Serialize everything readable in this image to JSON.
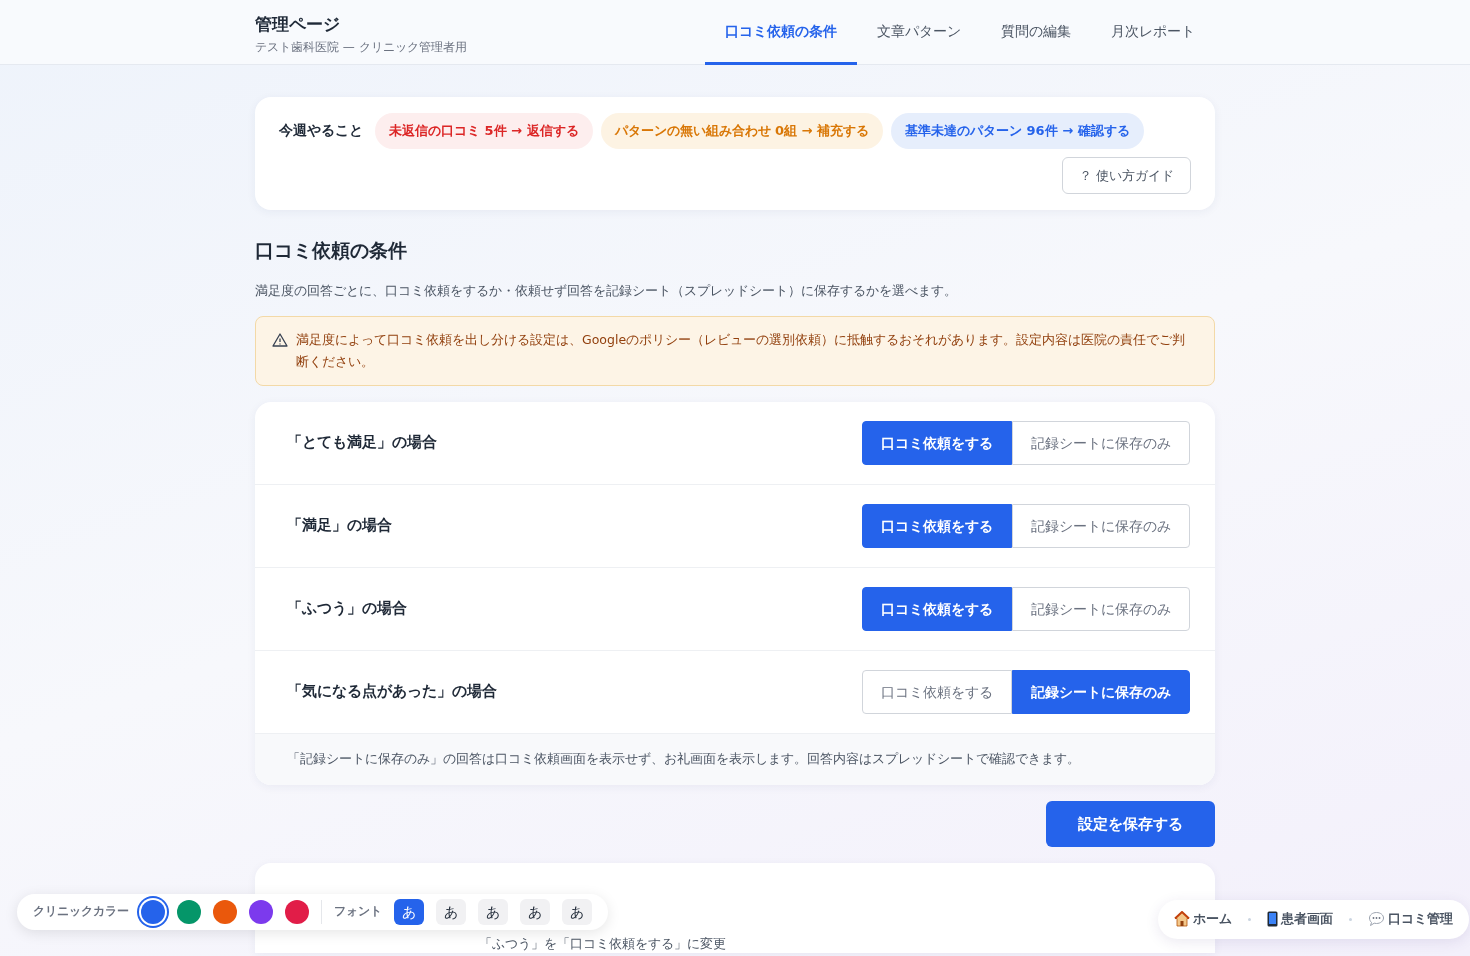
{
  "header": {
    "title": "管理ページ",
    "subtitle": "テスト歯科医院 — クリニック管理者用"
  },
  "tabs": [
    {
      "label": "口コミ依頼の条件",
      "selected": true
    },
    {
      "label": "文章パターン",
      "selected": false
    },
    {
      "label": "質問の編集",
      "selected": false
    },
    {
      "label": "月次レポート",
      "selected": false
    }
  ],
  "todo": {
    "label": "今週やること",
    "items": [
      {
        "text": "未返信の口コミ 5件 → 返信する",
        "kind": "danger"
      },
      {
        "text": "パターンの無い組み合わせ 0組 → 補充する",
        "kind": "warning"
      },
      {
        "text": "基準未達のパターン 96件 → 確認する",
        "kind": "info"
      }
    ],
    "guide_button": "？ 使い方ガイド"
  },
  "section": {
    "title": "口コミ依頼の条件",
    "description": "満足度の回答ごとに、口コミ依頼をするか・依頼せず回答を記録シート（スプレッドシート）に保存するかを選べます。",
    "warning": "満足度によって口コミ依頼を出し分ける設定は、Googleのポリシー（レビューの選別依頼）に抵触するおそれがあります。設定内容は医院の責任でご判断ください。"
  },
  "conditions": [
    {
      "label": "「とても満足」の場合",
      "options": [
        {
          "text": "口コミ依頼をする",
          "selected": true
        },
        {
          "text": "記録シートに保存のみ",
          "selected": false
        }
      ]
    },
    {
      "label": "「満足」の場合",
      "options": [
        {
          "text": "口コミ依頼をする",
          "selected": true
        },
        {
          "text": "記録シートに保存のみ",
          "selected": false
        }
      ]
    },
    {
      "label": "「ふつう」の場合",
      "options": [
        {
          "text": "口コミ依頼をする",
          "selected": true
        },
        {
          "text": "記録シートに保存のみ",
          "selected": false
        }
      ]
    },
    {
      "label": "「気になる点があった」の場合",
      "options": [
        {
          "text": "口コミ依頼をする",
          "selected": false
        },
        {
          "text": "記録シートに保存のみ",
          "selected": true
        }
      ]
    }
  ],
  "note": "「記録シートに保存のみ」の回答は口コミ依頼画面を表示せず、お礼画面を表示します。回答内容はスプレッドシートで確認できます。",
  "save_button": "設定を保存する",
  "history": {
    "rows": [
      {
        "column_3": "「ふつう」を「口コミ依頼をする」に変更"
      }
    ]
  },
  "color_bar": {
    "label": "クリニックカラー",
    "colors": [
      {
        "color": "#2563eb",
        "selected": true
      },
      {
        "color": "#059669",
        "selected": false
      },
      {
        "color": "#ea580c",
        "selected": false
      },
      {
        "color": "#7c3aed",
        "selected": false
      },
      {
        "color": "#e11d48",
        "selected": false
      }
    ],
    "font_label": "フォント",
    "fonts": [
      {
        "text": "あ",
        "selected": true
      },
      {
        "text": "あ",
        "selected": false
      },
      {
        "text": "あ",
        "selected": false
      },
      {
        "text": "あ",
        "selected": false
      },
      {
        "text": "あ",
        "selected": false
      }
    ]
  },
  "quick_nav": [
    {
      "text": "ホーム"
    },
    {
      "text": "患者画面"
    },
    {
      "text": "口コミ管理"
    }
  ]
}
